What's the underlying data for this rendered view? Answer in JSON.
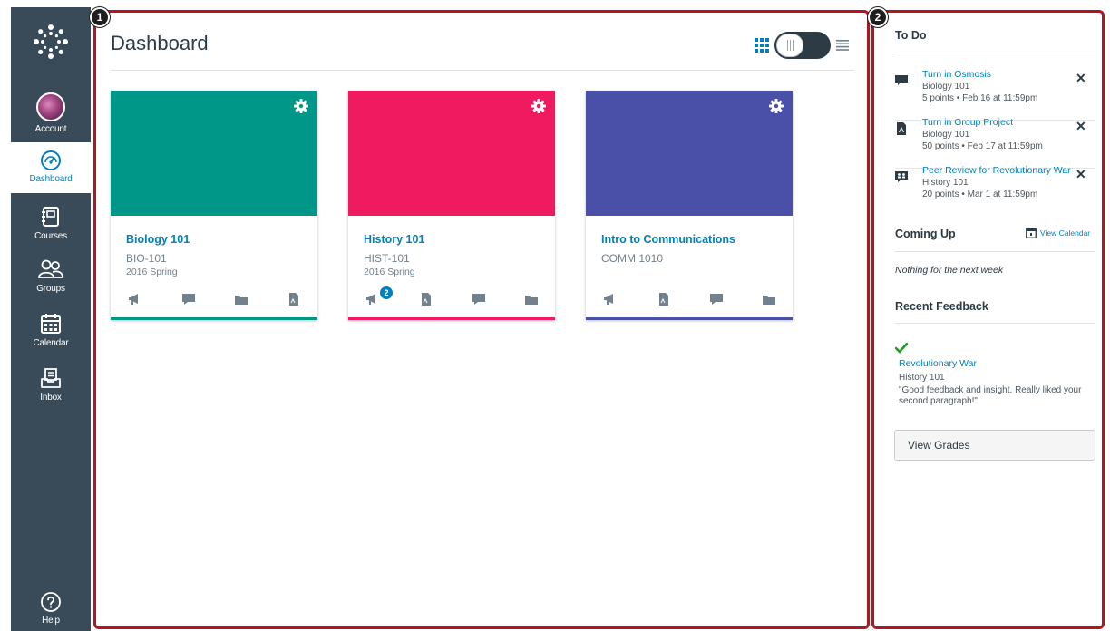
{
  "nav": {
    "account_label": "Account",
    "dashboard_label": "Dashboard",
    "courses_label": "Courses",
    "groups_label": "Groups",
    "calendar_label": "Calendar",
    "inbox_label": "Inbox",
    "help_label": "Help",
    "active_item": "Dashboard"
  },
  "callouts": {
    "main": "1",
    "sidebar": "2"
  },
  "header": {
    "title": "Dashboard",
    "view_mode": "card"
  },
  "cards": [
    {
      "name": "Biology 101",
      "code": "BIO-101",
      "term": "2016 Spring",
      "color": "#009688",
      "icons": [
        "announcements-icon",
        "discussions-icon",
        "files-icon",
        "assignments-icon"
      ]
    },
    {
      "name": "History 101",
      "code": "HIST-101",
      "term": "2016 Spring",
      "color": "#ef1a5f",
      "announcement_badge": "2",
      "icons": [
        "announcements-icon",
        "assignments-icon",
        "discussions-icon",
        "files-icon"
      ]
    },
    {
      "name": "Intro to Communications",
      "code": "COMM 1010",
      "term": "",
      "color": "#4a4fa8",
      "icons": [
        "announcements-icon",
        "assignments-icon",
        "discussions-icon",
        "files-icon"
      ]
    }
  ],
  "sidebar": {
    "todo_heading": "To Do",
    "todo_items": [
      {
        "title": "Turn in Osmosis",
        "course": "Biology 101",
        "meta": "5 points • Feb 16 at 11:59pm",
        "icon": "discussion-icon"
      },
      {
        "title": "Turn in Group Project",
        "course": "Biology 101",
        "meta": "50 points • Feb 17 at 11:59pm",
        "icon": "assignment-icon"
      },
      {
        "title": "Peer Review for Revolutionary War",
        "course": "History 101",
        "meta": "20 points • Mar 1 at 11:59pm",
        "icon": "peer-review-icon"
      }
    ],
    "close_glyph": "✕",
    "coming_up_heading": "Coming Up",
    "view_calendar_label": "View Calendar",
    "coming_up_empty": "Nothing for the next week",
    "recent_feedback_heading": "Recent Feedback",
    "feedback": {
      "title": "Revolutionary War",
      "course": "History 101",
      "comment": "\"Good feedback and insight. Really liked your second paragraph!\""
    },
    "view_grades_label": "View Grades"
  },
  "colors": {
    "nav_bg": "#394b58",
    "link": "#0081bd",
    "callout_border": "#b0161c",
    "check": "#1e9e1e"
  }
}
